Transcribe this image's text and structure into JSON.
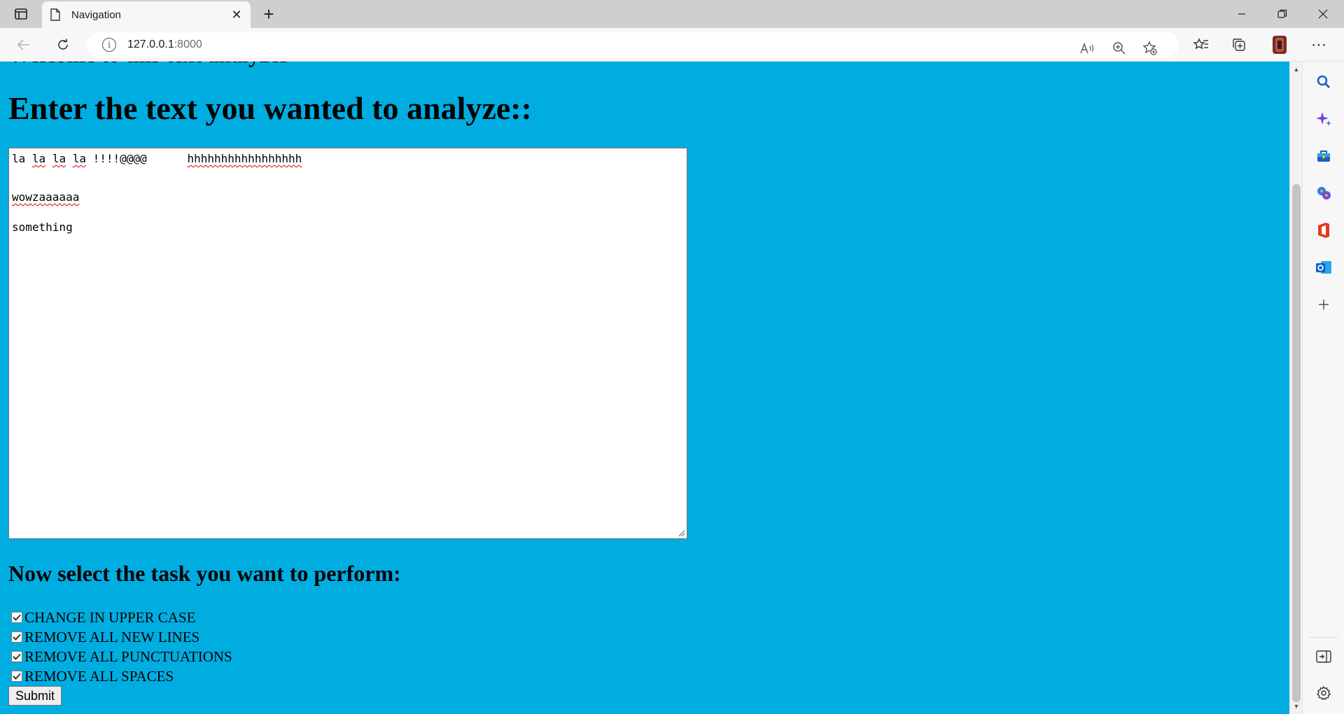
{
  "browser": {
    "tab_title": "Navigation",
    "address_host": "127.0.0.1",
    "address_port": ":8000",
    "new_tab_symbol": "+",
    "close_tab_symbol": "✕",
    "more_symbol": "⋯"
  },
  "page": {
    "partial_heading": "Welcome to this text analyzer",
    "main_heading": "Enter the text you wanted to analyze::",
    "textarea_lines": [
      "la la la la !!!!@@@@      hhhhhhhhhhhhhhhhh",
      "",
      "wowzaaaaaa",
      "",
      "something"
    ],
    "task_heading": "Now select the task you want to perform:",
    "options": [
      {
        "label": "CHANGE IN UPPER CASE",
        "checked": true
      },
      {
        "label": "REMOVE ALL NEW LINES",
        "checked": true
      },
      {
        "label": "REMOVE ALL PUNCTUATIONS",
        "checked": true
      },
      {
        "label": "REMOVE ALL SPACES",
        "checked": true
      }
    ],
    "submit_label": "Submit",
    "background_color": "#00ade0"
  },
  "icons": {
    "tab_actions": "tab-actions-icon",
    "favicon": "page-icon",
    "back": "back-arrow-icon",
    "refresh": "refresh-icon",
    "site_info": "info-icon",
    "read_aloud": "read-aloud-icon",
    "zoom": "zoom-icon",
    "add_favorite": "favorite-star-icon",
    "favorites": "favorites-icon",
    "collections": "collections-icon",
    "profile": "profile-avatar",
    "sidebar": [
      "search-icon",
      "copilot-icon",
      "shopping-icon",
      "games-icon",
      "office-icon",
      "outlook-icon",
      "add-icon",
      "hide-sidebar-icon",
      "settings-icon"
    ]
  }
}
